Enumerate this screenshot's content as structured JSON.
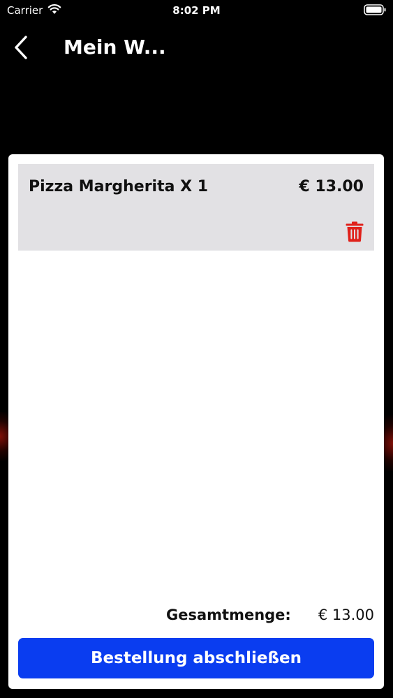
{
  "status_bar": {
    "carrier": "Carrier",
    "time": "8:02 PM"
  },
  "nav": {
    "title": "Mein W..."
  },
  "cart": {
    "items": [
      {
        "label": "Pizza Margherita X 1",
        "price": "€ 13.00"
      }
    ],
    "total_label": "Gesamtmenge:",
    "total_value": "€ 13.00"
  },
  "actions": {
    "checkout_label": "Bestellung abschließen"
  },
  "colors": {
    "background": "#000000",
    "card": "#ffffff",
    "item_background": "#e2e1e4",
    "accent_button": "#0a3df0",
    "delete_icon": "#e0211b"
  },
  "icons": {
    "back": "chevron-left-icon",
    "delete": "trash-icon",
    "wifi": "wifi-icon",
    "battery": "battery-icon"
  }
}
